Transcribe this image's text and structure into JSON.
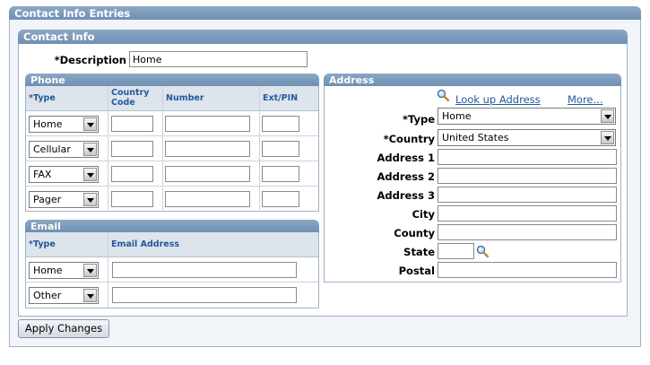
{
  "section_title": "Contact Info Entries",
  "contact_info_title": "Contact Info",
  "description": {
    "label": "*Description",
    "value": "Home"
  },
  "phone": {
    "title": "Phone",
    "headers": {
      "type": "*Type",
      "country_code": "Country Code",
      "number": "Number",
      "ext": "Ext/PIN"
    },
    "rows": [
      {
        "type": "Home",
        "country_code": "",
        "number": "",
        "ext": ""
      },
      {
        "type": "Cellular",
        "country_code": "",
        "number": "",
        "ext": ""
      },
      {
        "type": "FAX",
        "country_code": "",
        "number": "",
        "ext": ""
      },
      {
        "type": "Pager",
        "country_code": "",
        "number": "",
        "ext": ""
      }
    ]
  },
  "email": {
    "title": "Email",
    "headers": {
      "type": "*Type",
      "address": "Email Address"
    },
    "rows": [
      {
        "type": "Home",
        "address": ""
      },
      {
        "type": "Other",
        "address": ""
      }
    ]
  },
  "address": {
    "title": "Address",
    "lookup_link": "Look up Address",
    "more_link": "More...",
    "type_label": "*Type",
    "type_value": "Home",
    "country_label": "*Country",
    "country_value": "United States",
    "address1_label": "Address 1",
    "address1_value": "",
    "address2_label": "Address 2",
    "address2_value": "",
    "address3_label": "Address 3",
    "address3_value": "",
    "city_label": "City",
    "city_value": "",
    "county_label": "County",
    "county_value": "",
    "state_label": "State",
    "state_value": "",
    "postal_label": "Postal",
    "postal_value": ""
  },
  "apply_button": "Apply Changes",
  "icons": {
    "lookup": "magnifier-icon",
    "dropdown": "chevron-down-icon"
  }
}
